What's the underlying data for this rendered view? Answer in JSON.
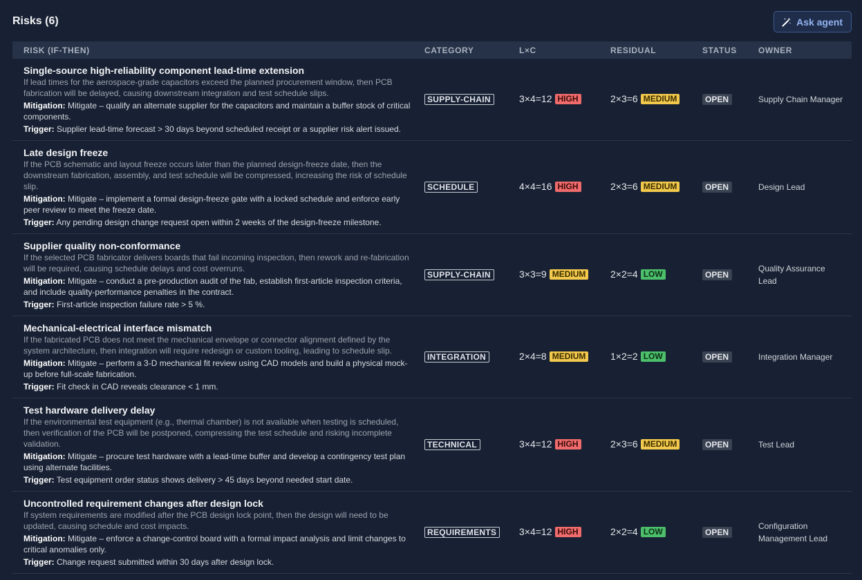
{
  "header": {
    "title": "Risks (6)",
    "ask_label": "Ask agent"
  },
  "table": {
    "columns": [
      "RISK (IF-THEN)",
      "CATEGORY",
      "L×C",
      "RESIDUAL",
      "STATUS",
      "OWNER"
    ],
    "rows": [
      {
        "title": "Single-source high-reliability component lead-time extension",
        "desc": "If lead times for the aerospace-grade capacitors exceed the planned procurement window, then PCB fabrication will be delayed, causing downstream integration and test schedule slips.",
        "mitigation_label": "Mitigation:",
        "mitigation": "Mitigate – qualify an alternate supplier for the capacitors and maintain a buffer stock of critical components.",
        "trigger_label": "Trigger:",
        "trigger": "Supplier lead-time forecast > 30 days beyond scheduled receipt or a supplier risk alert issued.",
        "category": "SUPPLY-CHAIN",
        "lxc": "3×4=12",
        "lxc_level": "HIGH",
        "residual": "2×3=6",
        "residual_level": "MEDIUM",
        "status": "OPEN",
        "owner": "Supply Chain Manager"
      },
      {
        "title": "Late design freeze",
        "desc": "If the PCB schematic and layout freeze occurs later than the planned design-freeze date, then the downstream fabrication, assembly, and test schedule will be compressed, increasing the risk of schedule slip.",
        "mitigation_label": "Mitigation:",
        "mitigation": "Mitigate – implement a formal design-freeze gate with a locked schedule and enforce early peer review to meet the freeze date.",
        "trigger_label": "Trigger:",
        "trigger": "Any pending design change request open within 2 weeks of the design-freeze milestone.",
        "category": "SCHEDULE",
        "lxc": "4×4=16",
        "lxc_level": "HIGH",
        "residual": "2×3=6",
        "residual_level": "MEDIUM",
        "status": "OPEN",
        "owner": "Design Lead"
      },
      {
        "title": "Supplier quality non-conformance",
        "desc": "If the selected PCB fabricator delivers boards that fail incoming inspection, then rework and re-fabrication will be required, causing schedule delays and cost overruns.",
        "mitigation_label": "Mitigation:",
        "mitigation": "Mitigate – conduct a pre-production audit of the fab, establish first-article inspection criteria, and include quality-performance penalties in the contract.",
        "trigger_label": "Trigger:",
        "trigger": "First-article inspection failure rate > 5 %.",
        "category": "SUPPLY-CHAIN",
        "lxc": "3×3=9",
        "lxc_level": "MEDIUM",
        "residual": "2×2=4",
        "residual_level": "LOW",
        "status": "OPEN",
        "owner": "Quality Assurance Lead"
      },
      {
        "title": "Mechanical-electrical interface mismatch",
        "desc": "If the fabricated PCB does not meet the mechanical envelope or connector alignment defined by the system architecture, then integration will require redesign or custom tooling, leading to schedule slip.",
        "mitigation_label": "Mitigation:",
        "mitigation": "Mitigate – perform a 3-D mechanical fit review using CAD models and build a physical mock-up before full-scale fabrication.",
        "trigger_label": "Trigger:",
        "trigger": "Fit check in CAD reveals clearance < 1 mm.",
        "category": "INTEGRATION",
        "lxc": "2×4=8",
        "lxc_level": "MEDIUM",
        "residual": "1×2=2",
        "residual_level": "LOW",
        "status": "OPEN",
        "owner": "Integration Manager"
      },
      {
        "title": "Test hardware delivery delay",
        "desc": "If the environmental test equipment (e.g., thermal chamber) is not available when testing is scheduled, then verification of the PCB will be postponed, compressing the test schedule and risking incomplete validation.",
        "mitigation_label": "Mitigation:",
        "mitigation": "Mitigate – procure test hardware with a lead-time buffer and develop a contingency test plan using alternate facilities.",
        "trigger_label": "Trigger:",
        "trigger": "Test equipment order status shows delivery > 45 days beyond needed start date.",
        "category": "TECHNICAL",
        "lxc": "3×4=12",
        "lxc_level": "HIGH",
        "residual": "2×3=6",
        "residual_level": "MEDIUM",
        "status": "OPEN",
        "owner": "Test Lead"
      },
      {
        "title": "Uncontrolled requirement changes after design lock",
        "desc": "If system requirements are modified after the PCB design lock point, then the design will need to be updated, causing schedule and cost impacts.",
        "mitigation_label": "Mitigation:",
        "mitigation": "Mitigate – enforce a change-control board with a formal impact analysis and limit changes to critical anomalies only.",
        "trigger_label": "Trigger:",
        "trigger": "Change request submitted within 30 days after design lock.",
        "category": "REQUIREMENTS",
        "lxc": "3×4=12",
        "lxc_level": "HIGH",
        "residual": "2×2=4",
        "residual_level": "LOW",
        "status": "OPEN",
        "owner": "Configuration Management Lead"
      }
    ]
  }
}
